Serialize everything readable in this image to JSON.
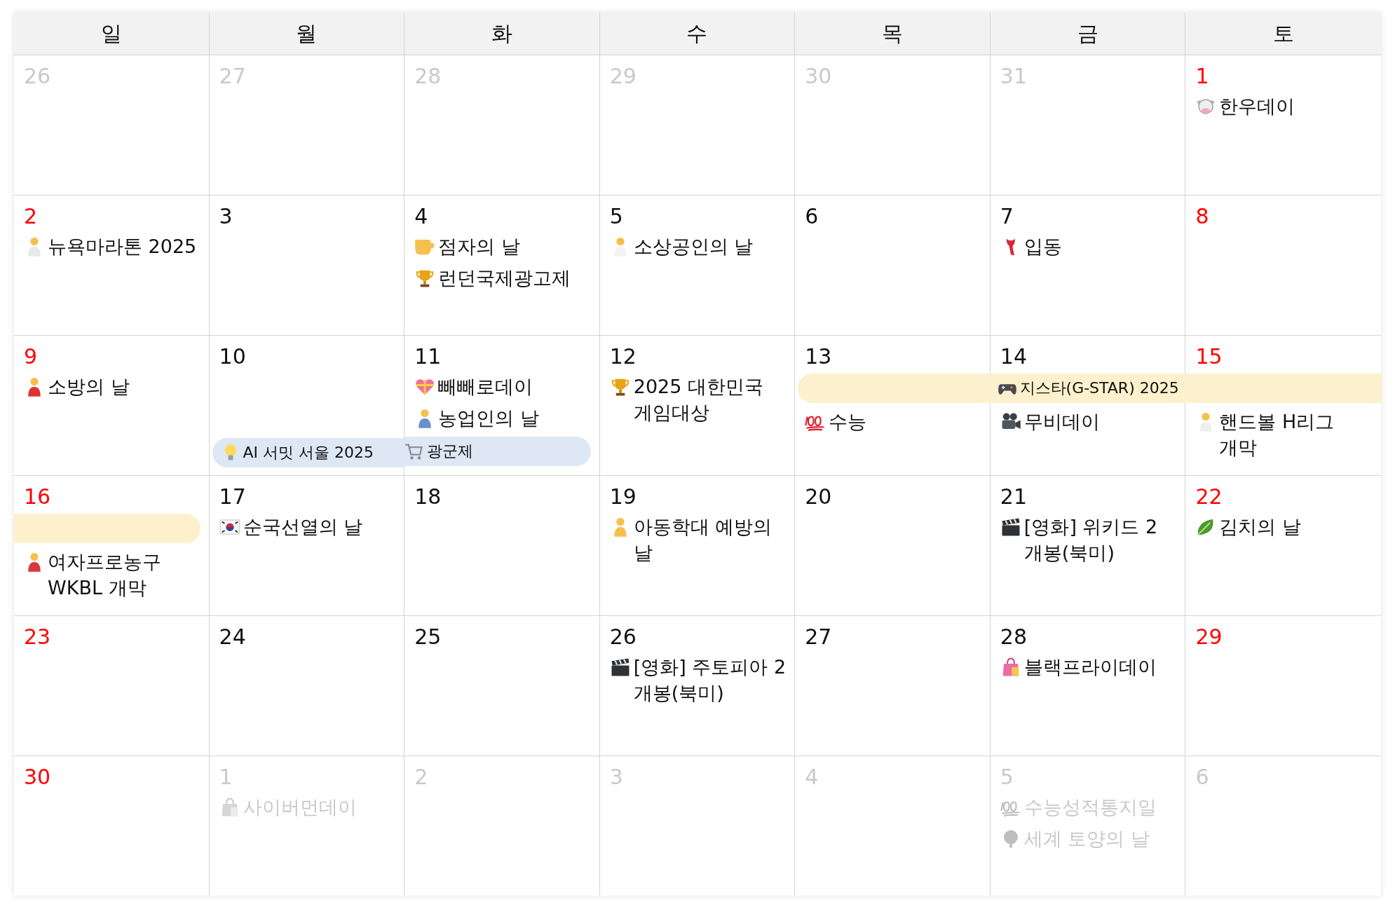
{
  "weekdays": [
    {
      "label": "일"
    },
    {
      "label": "월"
    },
    {
      "label": "화"
    },
    {
      "label": "수"
    },
    {
      "label": "목"
    },
    {
      "label": "금"
    },
    {
      "label": "토"
    }
  ],
  "weeks": [
    {
      "days": [
        {
          "date": "26",
          "muted": true
        },
        {
          "date": "27",
          "muted": true
        },
        {
          "date": "28",
          "muted": true
        },
        {
          "date": "29",
          "muted": true
        },
        {
          "date": "30",
          "muted": true
        },
        {
          "date": "31",
          "muted": true
        },
        {
          "date": "1",
          "muted": false,
          "weekend": true,
          "items": [
            {
              "kind": "event",
              "text": "한우데이"
            }
          ]
        }
      ]
    },
    {
      "days": [
        {
          "date": "2",
          "muted": false,
          "weekend": true,
          "items": [
            {
              "kind": "event",
              "text": "뉴욕마라톤 2025"
            }
          ]
        },
        {
          "date": "3",
          "muted": false,
          "weekend": false
        },
        {
          "date": "4",
          "muted": false,
          "weekend": false,
          "items": [
            {
              "kind": "event",
              "text": "점자의 날"
            },
            {
              "kind": "event",
              "text": "런던국제광고제"
            }
          ]
        },
        {
          "date": "5",
          "muted": false,
          "weekend": false,
          "items": [
            {
              "kind": "event",
              "text": "소상공인의 날"
            }
          ]
        },
        {
          "date": "6",
          "muted": false,
          "weekend": false
        },
        {
          "date": "7",
          "muted": false,
          "weekend": false,
          "items": [
            {
              "kind": "event",
              "text": "입동"
            }
          ]
        },
        {
          "date": "8",
          "muted": false,
          "weekend": true
        }
      ]
    },
    {
      "days": [
        {
          "date": "9",
          "muted": false,
          "weekend": true,
          "items": [
            {
              "kind": "event",
              "text": "소방의 날"
            }
          ]
        },
        {
          "date": "10",
          "muted": false,
          "weekend": false,
          "items": [
            {
              "kind": "blank"
            },
            {
              "kind": "blank"
            },
            {
              "kind": "bar",
              "color": "#dde8f4",
              "rounded_left": true,
              "rounded_right": false,
              "text": "AI 서밋 서울 2025"
            }
          ]
        },
        {
          "date": "11",
          "muted": false,
          "weekend": false,
          "items": [
            {
              "kind": "event",
              "text": "빼빼로데이"
            },
            {
              "kind": "event",
              "text": "농업인의 날"
            },
            {
              "kind": "bar",
              "color": "#dde8f4",
              "rounded_left": false,
              "rounded_right": true,
              "text": "광군제"
            }
          ]
        },
        {
          "date": "12",
          "muted": false,
          "weekend": false,
          "items": [
            {
              "kind": "event",
              "text": "2025 대한민국 게임대상"
            }
          ]
        },
        {
          "date": "13",
          "muted": false,
          "weekend": false,
          "items": [
            {
              "kind": "bar",
              "color": "#fdf0cc",
              "rounded_left": true,
              "rounded_right": false
            },
            {
              "kind": "event",
              "text": "수능"
            }
          ]
        },
        {
          "date": "14",
          "muted": false,
          "weekend": false,
          "items": [
            {
              "kind": "bar",
              "color": "#fdf0cc",
              "rounded_left": false,
              "rounded_right": false,
              "text": "지스타(G-STAR) 2025"
            },
            {
              "kind": "event",
              "text": "무비데이"
            }
          ]
        },
        {
          "date": "15",
          "muted": false,
          "weekend": true,
          "items": [
            {
              "kind": "bar",
              "color": "#fdf0cc",
              "rounded_left": false,
              "rounded_right": false
            },
            {
              "kind": "event",
              "text": "핸드볼 H리그 개막"
            }
          ]
        }
      ]
    },
    {
      "days": [
        {
          "date": "16",
          "muted": false,
          "weekend": true,
          "items": [
            {
              "kind": "bar",
              "color": "#fdf0cc",
              "rounded_left": false,
              "rounded_right": true
            },
            {
              "kind": "event",
              "text": "여자프로농구 WKBL 개막"
            }
          ]
        },
        {
          "date": "17",
          "muted": false,
          "weekend": false,
          "items": [
            {
              "kind": "event",
              "text": "순국선열의 날"
            }
          ]
        },
        {
          "date": "18",
          "muted": false,
          "weekend": false
        },
        {
          "date": "19",
          "muted": false,
          "weekend": false,
          "items": [
            {
              "kind": "event",
              "text": "아동학대 예방의 날"
            }
          ]
        },
        {
          "date": "20",
          "muted": false,
          "weekend": false
        },
        {
          "date": "21",
          "muted": false,
          "weekend": false,
          "items": [
            {
              "kind": "event",
              "text": "[영화] 위키드 2 개봉(북미)"
            }
          ]
        },
        {
          "date": "22",
          "muted": false,
          "weekend": true,
          "items": [
            {
              "kind": "event",
              "text": "김치의 날"
            }
          ]
        }
      ]
    },
    {
      "days": [
        {
          "date": "23",
          "muted": false,
          "weekend": true
        },
        {
          "date": "24",
          "muted": false,
          "weekend": false
        },
        {
          "date": "25",
          "muted": false,
          "weekend": false
        },
        {
          "date": "26",
          "muted": false,
          "weekend": false,
          "items": [
            {
              "kind": "event",
              "text": "[영화] 주토피아 2 개봉(북미)"
            }
          ]
        },
        {
          "date": "27",
          "muted": false,
          "weekend": false
        },
        {
          "date": "28",
          "muted": false,
          "weekend": false,
          "items": [
            {
              "kind": "event",
              "text": "블랙프라이데이"
            }
          ]
        },
        {
          "date": "29",
          "muted": false,
          "weekend": true
        }
      ]
    },
    {
      "days": [
        {
          "date": "30",
          "muted": false,
          "weekend": true
        },
        {
          "date": "1",
          "muted": true,
          "items": [
            {
              "kind": "event",
              "text": "사이버먼데이"
            }
          ]
        },
        {
          "date": "2",
          "muted": true
        },
        {
          "date": "3",
          "muted": true
        },
        {
          "date": "4",
          "muted": true
        },
        {
          "date": "5",
          "muted": true,
          "items": [
            {
              "kind": "event",
              "text": "수능성적통지일"
            },
            {
              "kind": "event",
              "text": "세계 토양의 날"
            }
          ]
        },
        {
          "date": "6",
          "muted": true
        }
      ]
    }
  ]
}
